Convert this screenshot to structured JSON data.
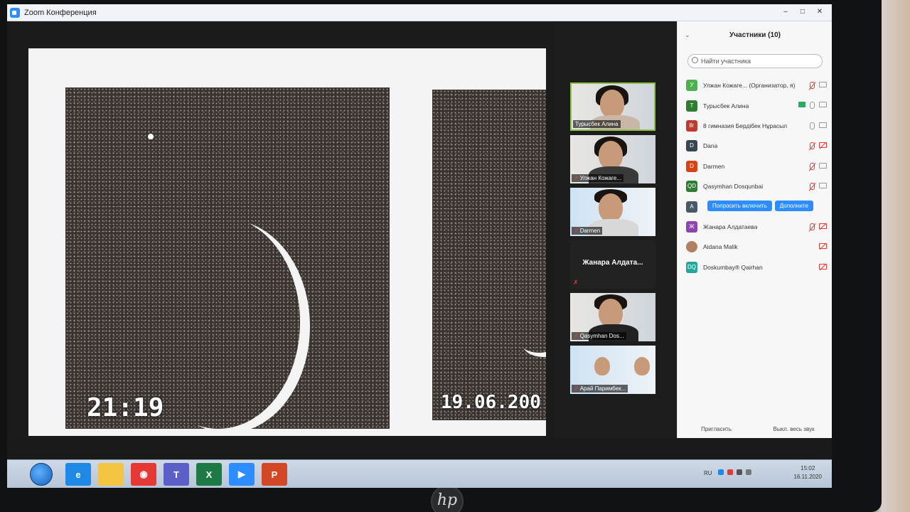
{
  "window": {
    "title": "Zoom Конференция",
    "controls": [
      "–",
      "□",
      "✕"
    ]
  },
  "shared_content": {
    "stamp_left": "21:19",
    "stamp_right": "19.06.200"
  },
  "video_tiles": [
    {
      "name": "Турысбек Алина",
      "muted": false,
      "active": true
    },
    {
      "name": "Улжан Кожаге...",
      "muted": true
    },
    {
      "name": "Darmen",
      "muted": true
    },
    {
      "name": "Жанара Алдата...",
      "muted": true,
      "video_off": true
    },
    {
      "name": "Qasymhan Dos...",
      "muted": true
    },
    {
      "name": "Арай Паримбек...",
      "muted": true
    }
  ],
  "participants": {
    "header": "Участники (10)",
    "collapse_icon": "chevron-down-icon",
    "search_placeholder": "Найти участника",
    "list": [
      {
        "initials": "У",
        "color": "#4caf50",
        "name": "Улжан Кожаге... (Организатор, я)",
        "mic": "muted",
        "cam": "on"
      },
      {
        "initials": "Т",
        "color": "#2e7d32",
        "name": "Турысбек Алина",
        "mic": "on",
        "cam": "on",
        "sharing": true
      },
      {
        "initials": "8г",
        "color": "#c0392b",
        "name": "8 гимназия Бердібек Нұрасыл",
        "mic": "on",
        "cam": "on"
      },
      {
        "initials": "D",
        "color": "#37474f",
        "name": "Dana",
        "mic": "muted",
        "cam": "off"
      },
      {
        "initials": "D",
        "color": "#d84315",
        "name": "Darmen",
        "mic": "muted",
        "cam": "on"
      },
      {
        "initials": "QD",
        "color": "#2e7d32",
        "name": "Qasymhan Dosqunbai",
        "mic": "muted",
        "cam": "on"
      },
      {
        "initials": "A",
        "color": "#455a64",
        "name": "",
        "buttons": [
          "Попросить включить",
          "Дополните"
        ]
      },
      {
        "initials": "Ж",
        "color": "#8e44ad",
        "name": "Жанара Алдатаева",
        "mic": "muted",
        "cam": "off"
      },
      {
        "initials": "",
        "color": "#b08060",
        "name": "Aidana Malik",
        "cam": "off"
      },
      {
        "initials": "DQ",
        "color": "#26a69a",
        "name": "Doskumbay® Qairhan",
        "cam": "off"
      }
    ],
    "footer": {
      "invite": "Пригласить",
      "mute_all": "Выкл. весь звук"
    }
  },
  "taskbar": {
    "apps": [
      {
        "name": "ie-icon",
        "color": "#1e88e5",
        "glyph": "e"
      },
      {
        "name": "explorer-icon",
        "color": "#f4c542",
        "glyph": ""
      },
      {
        "name": "chrome-icon",
        "color": "#e53935",
        "glyph": "◉"
      },
      {
        "name": "teams-icon",
        "color": "#5b5fc7",
        "glyph": "T"
      },
      {
        "name": "excel-icon",
        "color": "#1d7a44",
        "glyph": "X"
      },
      {
        "name": "zoom-icon",
        "color": "#2d8cff",
        "glyph": "▶"
      },
      {
        "name": "powerpoint-icon",
        "color": "#d24726",
        "glyph": "P"
      }
    ],
    "lang": "RU",
    "time": "15:02",
    "date": "16.11.2020"
  }
}
